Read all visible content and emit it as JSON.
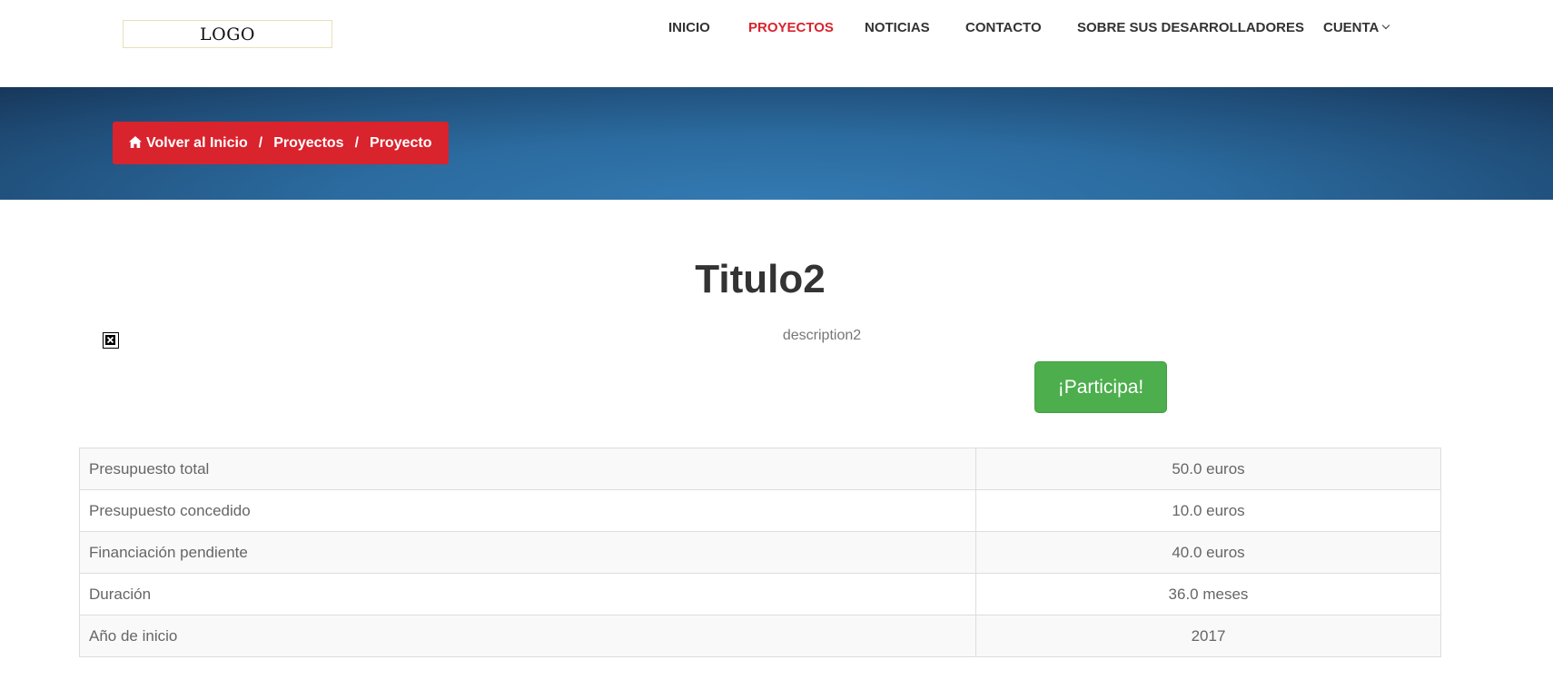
{
  "header": {
    "logo_text": "LOGO",
    "nav": [
      {
        "label": "INICIO",
        "active": false
      },
      {
        "label": "PROYECTOS",
        "active": true
      },
      {
        "label": "NOTICIAS",
        "active": false
      },
      {
        "label": "CONTACTO",
        "active": false
      },
      {
        "label": "SOBRE SUS DESARROLLADORES",
        "active": false
      },
      {
        "label": "CUENTA",
        "active": false,
        "dropdown": true
      }
    ]
  },
  "breadcrumb": {
    "home_icon": "home-icon",
    "items": [
      "Volver al Inicio",
      "Proyectos",
      "Proyecto"
    ],
    "separator": "/"
  },
  "project": {
    "title": "Titulo2",
    "description": "description2",
    "image_icon": "broken-image-icon",
    "cta_label": "¡Participa!"
  },
  "details": [
    {
      "label": "Presupuesto total",
      "value": "50.0 euros"
    },
    {
      "label": "Presupuesto concedido",
      "value": "10.0 euros"
    },
    {
      "label": "Financiación pendiente",
      "value": "40.0 euros"
    },
    {
      "label": "Duración",
      "value": "36.0 meses"
    },
    {
      "label": "Año de inicio",
      "value": "2017"
    }
  ],
  "colors": {
    "accent_red": "#d9232d",
    "cta_green": "#4cae4c",
    "banner_blue": "#2b6b9f"
  }
}
